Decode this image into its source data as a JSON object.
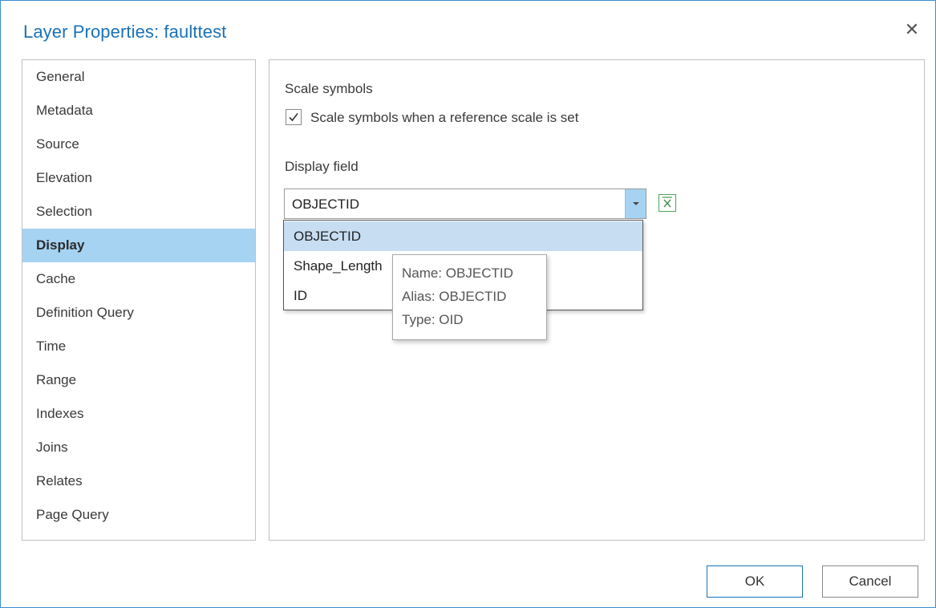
{
  "dialog": {
    "title": "Layer Properties: faulttest",
    "close_glyph": "✕"
  },
  "sidebar": {
    "items": [
      {
        "label": "General"
      },
      {
        "label": "Metadata"
      },
      {
        "label": "Source"
      },
      {
        "label": "Elevation"
      },
      {
        "label": "Selection"
      },
      {
        "label": "Display",
        "selected": true
      },
      {
        "label": "Cache"
      },
      {
        "label": "Definition Query"
      },
      {
        "label": "Time"
      },
      {
        "label": "Range"
      },
      {
        "label": "Indexes"
      },
      {
        "label": "Joins"
      },
      {
        "label": "Relates"
      },
      {
        "label": "Page Query"
      }
    ]
  },
  "display": {
    "scale_heading": "Scale symbols",
    "scale_checkbox_label": "Scale symbols when a reference scale is set",
    "scale_checked": true,
    "field_heading": "Display field",
    "field_value": "OBJECTID",
    "options": [
      "OBJECTID",
      "Shape_Length",
      "ID"
    ],
    "highlighted_option": "OBJECTID"
  },
  "tooltip": {
    "name": "Name: OBJECTID",
    "alias": "Alias: OBJECTID",
    "type": "Type: OID"
  },
  "buttons": {
    "ok": "OK",
    "cancel": "Cancel"
  },
  "colors": {
    "title": "#1a72b8",
    "selection": "#a6d3f2",
    "dropdown_highlight": "#c7def2",
    "expression_icon": "#4fa35a"
  },
  "icons": [
    "close-icon",
    "checkmark-icon",
    "chevron-down-icon",
    "expression-icon"
  ]
}
